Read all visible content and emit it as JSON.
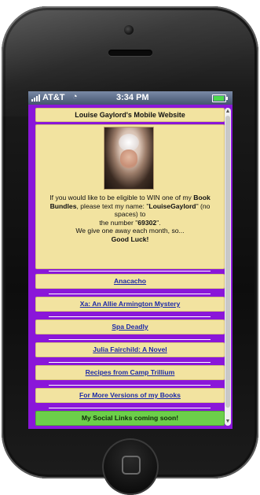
{
  "status_bar": {
    "carrier": "AT&T",
    "time": "3:34 PM"
  },
  "page": {
    "title": "Louise Gaylord's Mobile Website",
    "intro": {
      "line1_a": "If you would like to be eligible to WIN one of my ",
      "line1_b": "Book Bundles",
      "line1_c": ", please text my name: \"",
      "name": "LouiseGaylord",
      "line1_d": "\" (no spaces) to",
      "line2_a": "the number \"",
      "number": "69302",
      "line2_b": "\".",
      "line3": "We give one away each month, so...",
      "line4": "Good Luck!"
    },
    "links": [
      "Anacacho",
      "Xa: An Allie Armington Mystery",
      "Spa Deadly",
      "Julia Fairchild: A Novel",
      "Recipes from Camp Trillium",
      "For More Versions of my Books"
    ],
    "social": "My Social Links coming soon!"
  },
  "colors": {
    "background": "#8a16d9",
    "panel": "#f2e3a0",
    "link": "#1d2aa8",
    "social": "#6ccf4a"
  }
}
